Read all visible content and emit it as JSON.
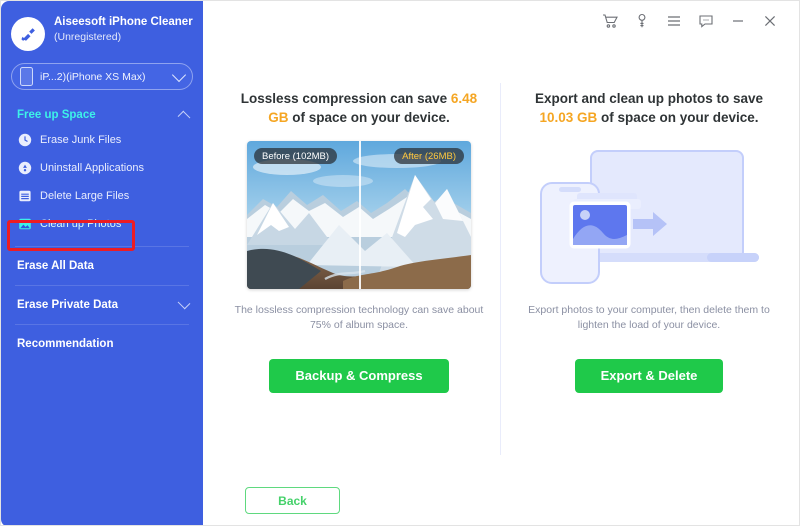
{
  "window": {
    "titlebar_icons": [
      {
        "name": "cart-icon",
        "label": "Cart"
      },
      {
        "name": "key-icon",
        "label": "Register"
      },
      {
        "name": "menu-icon",
        "label": "Menu"
      },
      {
        "name": "feedback-icon",
        "label": "Feedback"
      },
      {
        "name": "minimize-icon",
        "label": "Minimize"
      },
      {
        "name": "close-icon",
        "label": "Close"
      }
    ]
  },
  "sidebar": {
    "app_name": "Aiseesoft iPhone Cleaner",
    "app_status": "(Unregistered)",
    "device": {
      "label": "iP...2)(iPhone XS Max)",
      "icon": "phone-icon",
      "chevron": "chevron-down-icon"
    },
    "groups": [
      {
        "label": "Free up Space",
        "expanded": true,
        "chevron": "chevron-up-icon",
        "items": [
          {
            "label": "Erase Junk Files",
            "icon": "clock-icon",
            "selected": false
          },
          {
            "label": "Uninstall Applications",
            "icon": "app-uninstall-icon",
            "selected": false
          },
          {
            "label": "Delete Large Files",
            "icon": "file-list-icon",
            "selected": false
          },
          {
            "label": "Clean up Photos",
            "icon": "photo-icon",
            "selected": true
          }
        ]
      },
      {
        "label": "Erase All Data",
        "expanded": false,
        "chevron": "",
        "items": []
      },
      {
        "label": "Erase Private Data",
        "expanded": false,
        "chevron": "chevron-down-icon",
        "items": []
      },
      {
        "label": "Recommendation",
        "expanded": false,
        "chevron": "",
        "items": []
      }
    ],
    "highlight": {
      "target": "Clean up Photos",
      "color": "#ec1c24"
    }
  },
  "main": {
    "panels": [
      {
        "heading_prefix": "Lossless compression can save ",
        "heading_value": "6.48 GB",
        "heading_suffix": " of space on your device.",
        "media": {
          "type": "before-after-photo",
          "before_tag": "Before (102MB)",
          "after_tag": "After (26MB)",
          "alt": "Snowy mountain landscape"
        },
        "caption": "The lossless compression technology can save about 75% of album space.",
        "cta": "Backup & Compress"
      },
      {
        "heading_prefix": "Export and clean up photos to save ",
        "heading_value": "10.03 GB",
        "heading_suffix": " of space on your device.",
        "media": {
          "type": "illustration",
          "alt": "Phone exporting photos to laptop"
        },
        "caption": "Export photos to your computer, then delete them to lighten the load of your device.",
        "cta": "Export & Delete"
      }
    ],
    "back_label": "Back"
  },
  "colors": {
    "sidebar_blue": "#3e5fe0",
    "accent_cyan": "#3df2e8",
    "accent_orange": "#f5a623",
    "cta_green": "#1fc94a",
    "highlight_red": "#ec1c24"
  }
}
